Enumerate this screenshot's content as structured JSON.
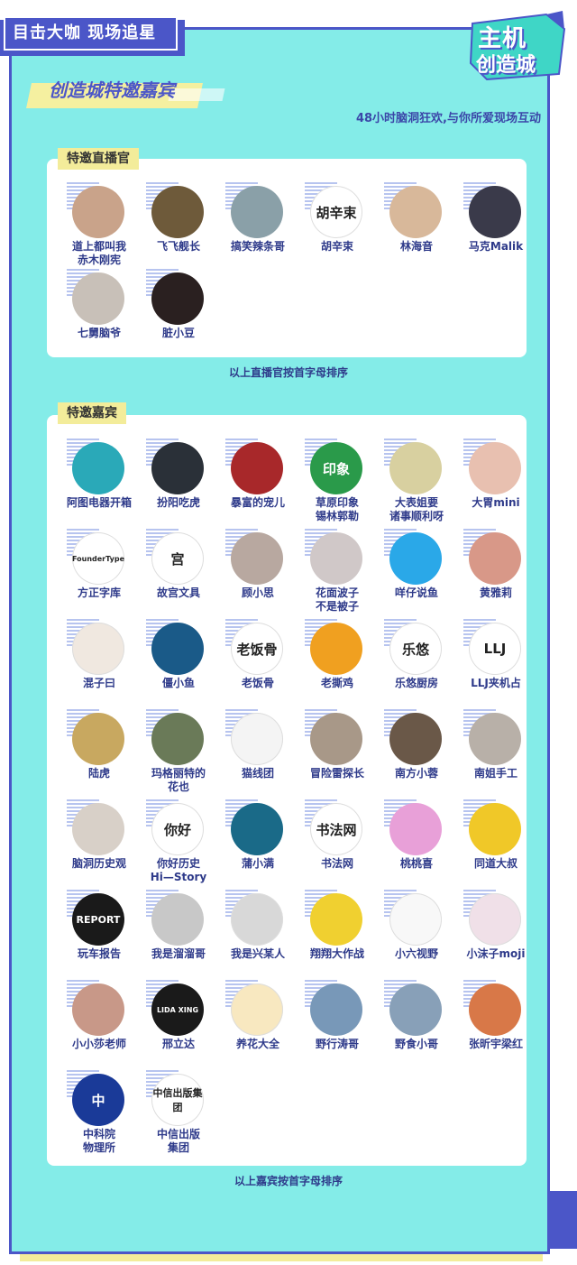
{
  "header": {
    "tag": "目击大咖 现场追星",
    "logo_line1": "主机",
    "logo_line2": "创造城"
  },
  "title": "创造城特邀嘉宾",
  "subtitle": "48小时脑洞狂欢,与你所爱现场互动",
  "host_section": {
    "label": "特邀直播官",
    "items": [
      {
        "name": "道上都叫我\n赤木刚宪",
        "color": "#c9a38a",
        "glyph": ""
      },
      {
        "name": "飞飞舰长",
        "color": "#6e5a3a",
        "glyph": ""
      },
      {
        "name": "搞笑辣条哥",
        "color": "#8aa0a8",
        "glyph": ""
      },
      {
        "name": "胡辛束",
        "color": "#ffffff",
        "glyph": "胡辛束"
      },
      {
        "name": "林海音",
        "color": "#d8b89a",
        "glyph": ""
      },
      {
        "name": "马克Malik",
        "color": "#3a3a4a",
        "glyph": ""
      },
      {
        "name": "七舅脑爷",
        "color": "#c8c0b8",
        "glyph": ""
      },
      {
        "name": "脏小豆",
        "color": "#2a2020",
        "glyph": ""
      }
    ],
    "footnote": "以上直播官按首字母排序"
  },
  "guest_section": {
    "label": "特邀嘉宾",
    "items": [
      {
        "name": "阿图电器开箱",
        "color": "#2aa9b8",
        "glyph": ""
      },
      {
        "name": "扮阳吃虎",
        "color": "#2a3038",
        "glyph": ""
      },
      {
        "name": "暴富的宠儿",
        "color": "#a8282a",
        "glyph": ""
      },
      {
        "name": "草原印象\n锡林郭勒",
        "color": "#2a9a4a",
        "glyph": "印象"
      },
      {
        "name": "大表姐要\n诸事顺利呀",
        "color": "#d8d0a0",
        "glyph": ""
      },
      {
        "name": "大胃mini",
        "color": "#e8c0b0",
        "glyph": ""
      },
      {
        "name": "方正字库",
        "color": "#ffffff",
        "glyph": "FounderType"
      },
      {
        "name": "故宫文具",
        "color": "#ffffff",
        "glyph": "宫"
      },
      {
        "name": "顾小思",
        "color": "#b8a8a0",
        "glyph": ""
      },
      {
        "name": "花面波子\n不是被子",
        "color": "#d0c8c8",
        "glyph": ""
      },
      {
        "name": "咩仔说鱼",
        "color": "#2aa8e8",
        "glyph": ""
      },
      {
        "name": "黄雅莉",
        "color": "#d89888",
        "glyph": ""
      },
      {
        "name": "混子曰",
        "color": "#f0e8e0",
        "glyph": ""
      },
      {
        "name": "僵小鱼",
        "color": "#1a5a88",
        "glyph": ""
      },
      {
        "name": "老饭骨",
        "color": "#ffffff",
        "glyph": "老饭骨"
      },
      {
        "name": "老撕鸡",
        "color": "#f0a020",
        "glyph": ""
      },
      {
        "name": "乐悠厨房",
        "color": "#ffffff",
        "glyph": "乐悠"
      },
      {
        "name": "LLJ夹机占",
        "color": "#ffffff",
        "glyph": "LLJ"
      },
      {
        "name": "陆虎",
        "color": "#c8a860",
        "glyph": ""
      },
      {
        "name": "玛格丽特的\n花也",
        "color": "#6a7a58",
        "glyph": ""
      },
      {
        "name": "猫线团",
        "color": "#f4f4f4",
        "glyph": ""
      },
      {
        "name": "冒险雷探长",
        "color": "#a89888",
        "glyph": ""
      },
      {
        "name": "南方小蓉",
        "color": "#6a5848",
        "glyph": ""
      },
      {
        "name": "南姐手工",
        "color": "#b8b0a8",
        "glyph": ""
      },
      {
        "name": "脑洞历史观",
        "color": "#d8d0c8",
        "glyph": ""
      },
      {
        "name": "你好历史\nHi—Story",
        "color": "#ffffff",
        "glyph": "你好"
      },
      {
        "name": "蒲小满",
        "color": "#1a6a88",
        "glyph": ""
      },
      {
        "name": "书法网",
        "color": "#ffffff",
        "glyph": "书法网"
      },
      {
        "name": "桃桃喜",
        "color": "#e8a0d8",
        "glyph": ""
      },
      {
        "name": "同道大叔",
        "color": "#f0c828",
        "glyph": ""
      },
      {
        "name": "玩车报告",
        "color": "#1a1a1a",
        "glyph": "REPORT"
      },
      {
        "name": "我是溜溜哥",
        "color": "#c8c8c8",
        "glyph": ""
      },
      {
        "name": "我是兴某人",
        "color": "#d8d8d8",
        "glyph": ""
      },
      {
        "name": "翔翔大作战",
        "color": "#f0d030",
        "glyph": ""
      },
      {
        "name": "小六视野",
        "color": "#f8f8f8",
        "glyph": ""
      },
      {
        "name": "小沫子moji",
        "color": "#f0e0e8",
        "glyph": ""
      },
      {
        "name": "小小莎老师",
        "color": "#c89888",
        "glyph": ""
      },
      {
        "name": "邢立达",
        "color": "#1a1a1a",
        "glyph": "LIDA XING"
      },
      {
        "name": "养花大全",
        "color": "#f8e8c0",
        "glyph": ""
      },
      {
        "name": "野行涛哥",
        "color": "#7898b8",
        "glyph": ""
      },
      {
        "name": "野食小哥",
        "color": "#88a0b8",
        "glyph": ""
      },
      {
        "name": "张昕宇梁红",
        "color": "#d87848",
        "glyph": ""
      },
      {
        "name": "中科院\n物理所",
        "color": "#1a3a98",
        "glyph": "中"
      },
      {
        "name": "中信出版\n集团",
        "color": "#ffffff",
        "glyph": "中信出版集团"
      }
    ],
    "footnote": "以上嘉宾按首字母排序"
  }
}
